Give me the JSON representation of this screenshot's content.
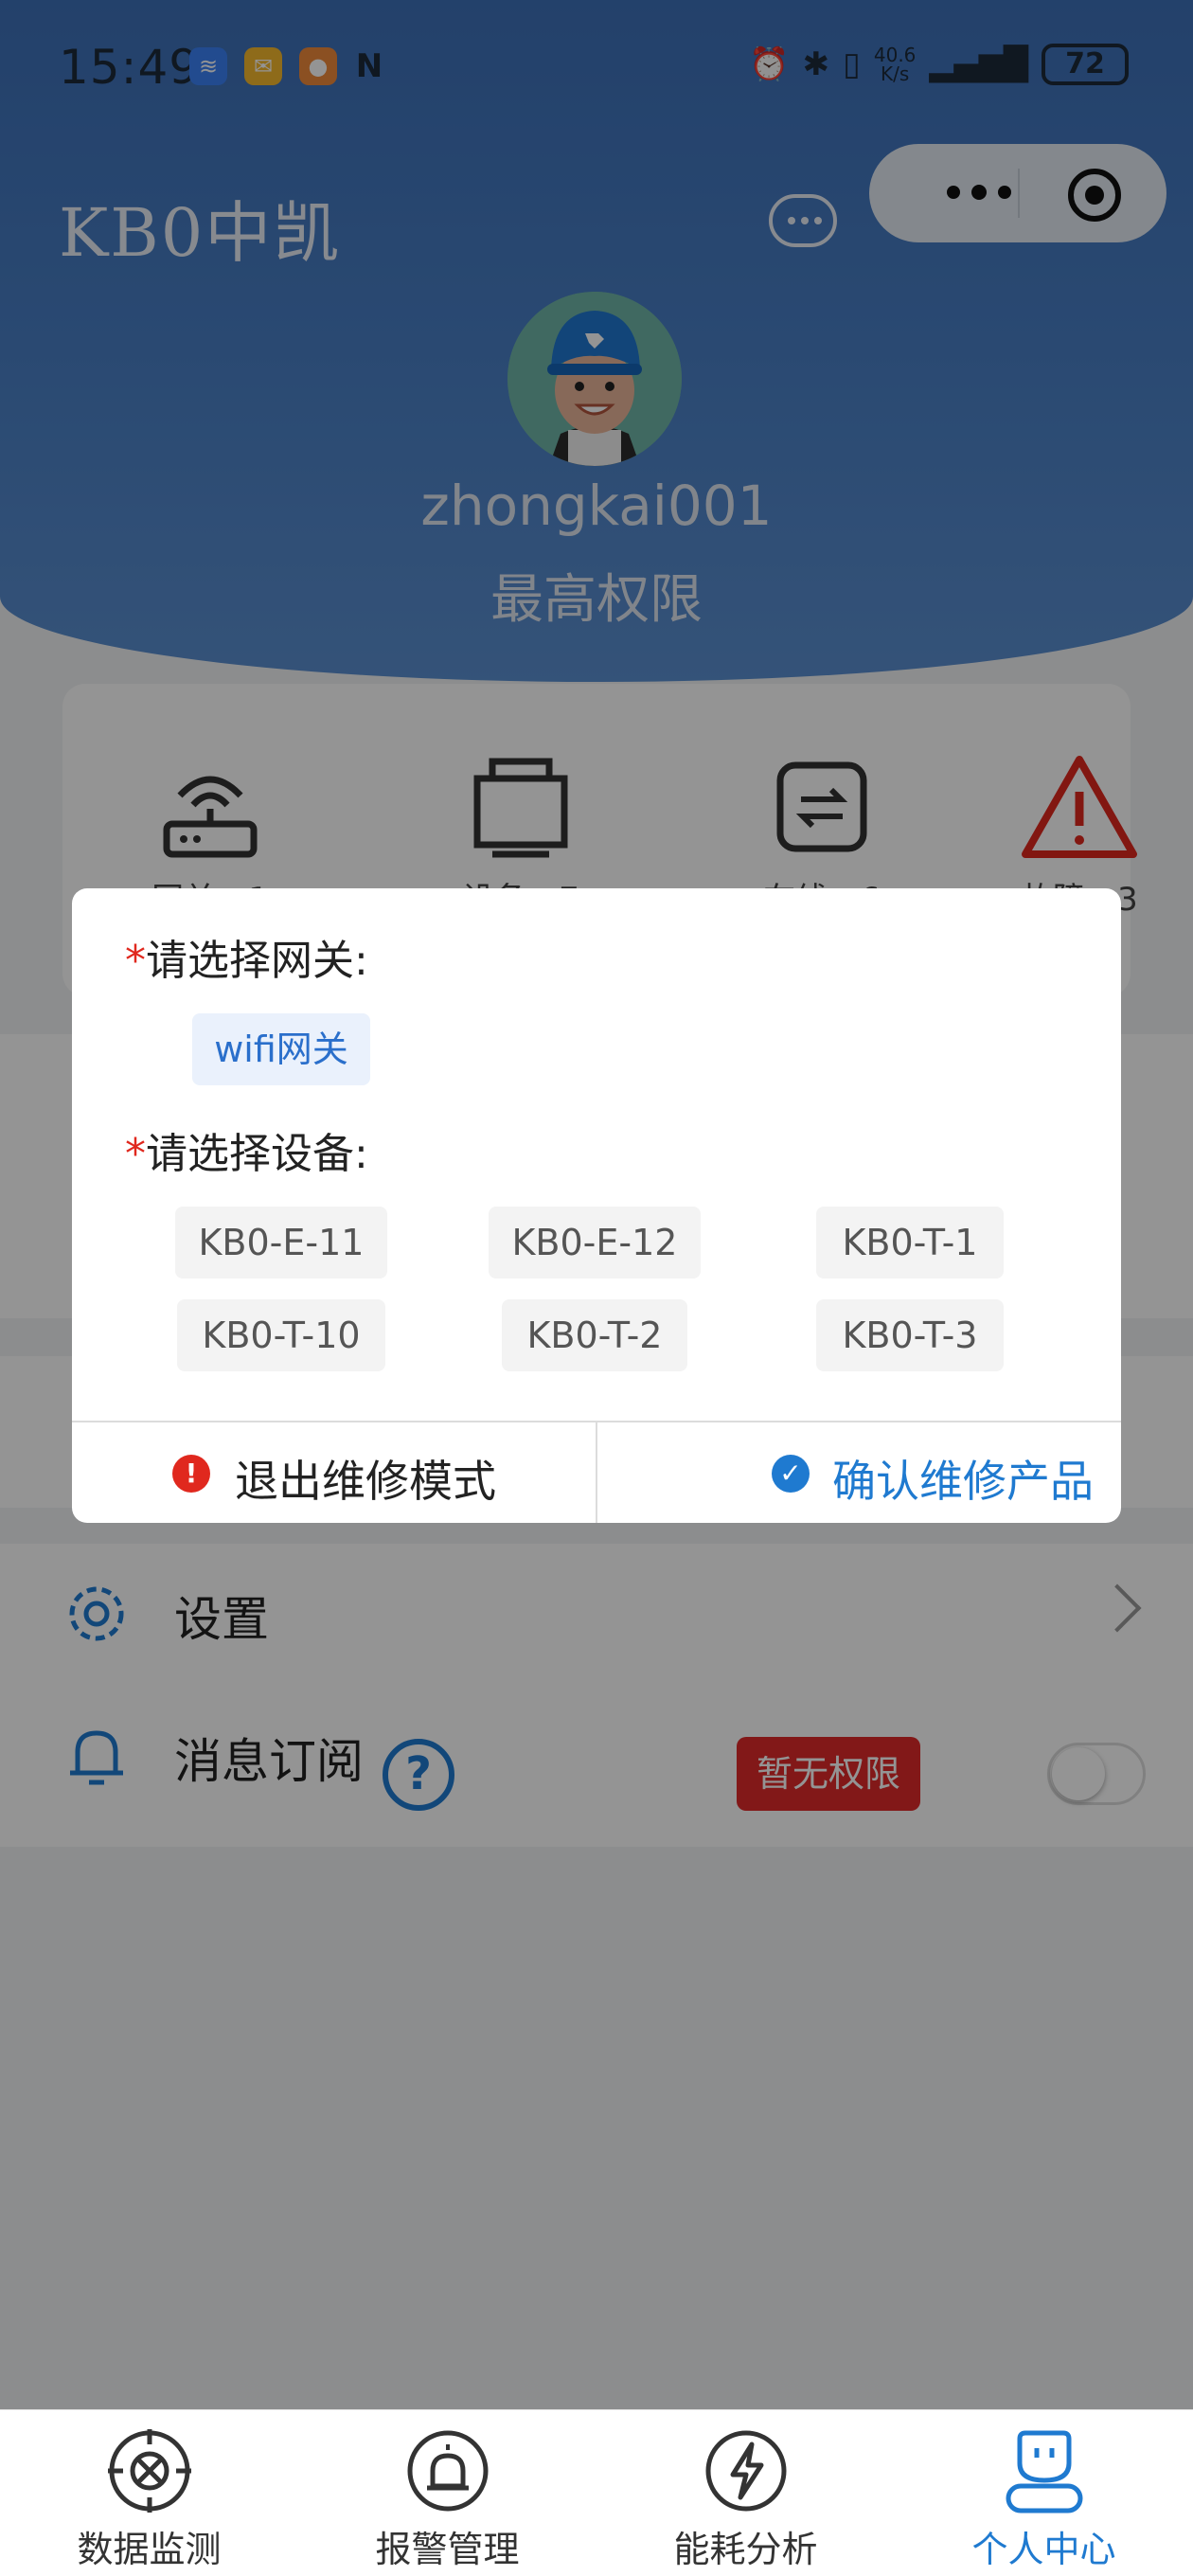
{
  "status_bar": {
    "time": "15:49",
    "net_speed_value": "40.6",
    "net_speed_unit": "K/s",
    "battery": "72"
  },
  "header": {
    "brand": "KB0中凯",
    "username": "zhongkai001",
    "role": "最高权限"
  },
  "stats": [
    {
      "label": "网关：1",
      "icon": "router-icon"
    },
    {
      "label": "设备：7",
      "icon": "device-icon"
    },
    {
      "label": "在线：6",
      "icon": "online-icon"
    },
    {
      "label": "故障：3",
      "icon": "warning-icon"
    }
  ],
  "menu": {
    "settings_label": "设置",
    "subscribe_label": "消息订阅",
    "help_symbol": "?",
    "no_permission_badge": "暂无权限"
  },
  "dialog": {
    "gateway_label": "请选择网关:",
    "device_label": "请选择设备:",
    "required_mark": "*",
    "gateways": [
      {
        "label": "wifi网关",
        "selected": true
      }
    ],
    "devices": [
      {
        "label": "KB0-E-11"
      },
      {
        "label": "KB0-E-12"
      },
      {
        "label": "KB0-T-1"
      },
      {
        "label": "KB0-T-10"
      },
      {
        "label": "KB0-T-2"
      },
      {
        "label": "KB0-T-3"
      }
    ],
    "exit_button": "退出维修模式",
    "confirm_button": "确认维修产品"
  },
  "tabs": [
    {
      "label": "数据监测",
      "icon": "monitor-icon",
      "active": false
    },
    {
      "label": "报警管理",
      "icon": "alarm-icon",
      "active": false
    },
    {
      "label": "能耗分析",
      "icon": "energy-icon",
      "active": false
    },
    {
      "label": "个人中心",
      "icon": "profile-icon",
      "active": true
    }
  ],
  "colors": {
    "header_blue": "#4a80c6",
    "accent": "#1f7ad0",
    "danger": "#e0281e"
  }
}
